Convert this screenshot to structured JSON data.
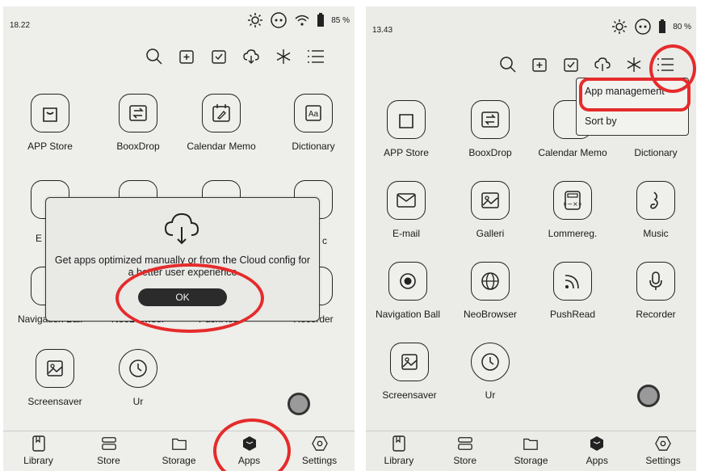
{
  "left": {
    "status": {
      "time": "18.22",
      "battery": "85 %"
    },
    "apps": [
      {
        "label": "APP Store",
        "icon": "bag-icon"
      },
      {
        "label": "BooxDrop",
        "icon": "transfer-icon"
      },
      {
        "label": "Calendar Memo",
        "icon": "calendar-memo-icon"
      },
      {
        "label": "Dictionary",
        "icon": "dictionary-icon"
      },
      {
        "label": "Navigation Ball",
        "icon": "navigation-ball-icon"
      },
      {
        "label": "NeoBrowser",
        "icon": "globe-icon"
      },
      {
        "label": "PushRead",
        "icon": "rss-icon"
      },
      {
        "label": "Recorder",
        "icon": "microphone-icon"
      },
      {
        "label": "Screensaver",
        "icon": "image-icon"
      },
      {
        "label": "Ur",
        "icon": "clock-icon"
      }
    ],
    "dialog": {
      "message": "Get apps optimized manually or from the Cloud config for a better user experience",
      "ok": "OK",
      "icon": "cloud-download-icon"
    },
    "partial_labels": [
      "E",
      "c"
    ]
  },
  "right": {
    "status": {
      "time": "13.43",
      "battery": "80 %"
    },
    "apps": [
      {
        "label": "APP Store",
        "icon": "bag-icon"
      },
      {
        "label": "BooxDrop",
        "icon": "transfer-icon"
      },
      {
        "label": "Calendar Memo",
        "icon": "calendar-memo-icon"
      },
      {
        "label": "Dictionary",
        "icon": "dictionary-icon"
      },
      {
        "label": "E-mail",
        "icon": "mail-icon"
      },
      {
        "label": "Galleri",
        "icon": "gallery-icon"
      },
      {
        "label": "Lommereg.",
        "icon": "calculator-icon"
      },
      {
        "label": "Music",
        "icon": "music-icon"
      },
      {
        "label": "Navigation Ball",
        "icon": "navigation-ball-icon"
      },
      {
        "label": "NeoBrowser",
        "icon": "globe-icon"
      },
      {
        "label": "PushRead",
        "icon": "rss-icon"
      },
      {
        "label": "Recorder",
        "icon": "microphone-icon"
      },
      {
        "label": "Screensaver",
        "icon": "image-icon"
      },
      {
        "label": "Ur",
        "icon": "clock-icon"
      }
    ],
    "menu": {
      "items": [
        "App management",
        "Sort by"
      ]
    }
  },
  "bottom_nav": [
    "Library",
    "Store",
    "Storage",
    "Apps",
    "Settings"
  ],
  "colors": {
    "annotation": "#e52b2b",
    "screen": "#eeeeea",
    "ink": "#1a1a1a"
  }
}
